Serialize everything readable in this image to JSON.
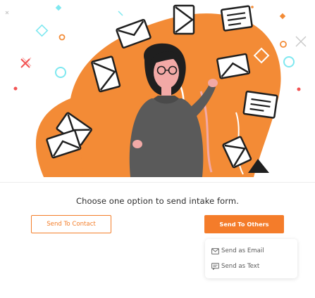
{
  "prompt": {
    "text": "Choose one option to send intake form."
  },
  "actions": {
    "send_to_contact_label": "Send To Contact",
    "send_to_others_label": "Send To Others"
  },
  "send_options_menu": {
    "items": [
      {
        "label": "Send as Email",
        "icon": "envelope-icon"
      },
      {
        "label": "Send as Text",
        "icon": "message-icon"
      }
    ]
  },
  "theme": {
    "accent": "#f47c2a",
    "illustration_orange": "#f38b36",
    "illustration_dark": "#1f1f1f",
    "illustration_sweater": "#5a5a5a",
    "illustration_pink": "#f2a9a6",
    "decoration_cyan": "#7ee8f0",
    "decoration_red": "#f25353",
    "decoration_gray": "#c8c8c8"
  }
}
